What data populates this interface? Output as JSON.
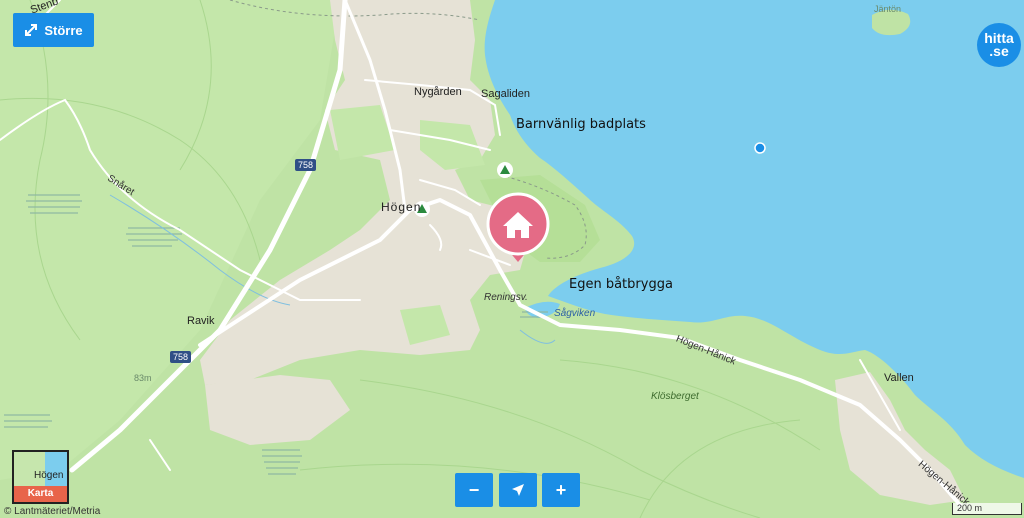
{
  "controls": {
    "larger_label": "Större",
    "zoom_out_label": "−",
    "zoom_in_label": "+"
  },
  "logo": {
    "line1": "hitta",
    "line2": ".se"
  },
  "layer_switcher": {
    "place": "Högen",
    "label": "Karta"
  },
  "attribution": "© Lantmäteriet/Metria",
  "scale_label": "200 m",
  "annotations": {
    "beach": "Barnvänlig badplats",
    "jetty": "Egen båtbrygga"
  },
  "labels": {
    "jantan": "Jäntön",
    "stenb": "Stenb",
    "nygarden": "Nygården",
    "sagaliden": "Sagaliden",
    "hogen": "Högen",
    "snaret": "Snåret",
    "ravik": "Ravik",
    "elevation": "83m",
    "reningsv": "Reningsv.",
    "sagviken": "Sågviken",
    "hogen_hanick_1": "Högen-Hånick",
    "hogen_hanick_2": "Högen-Hånick",
    "klosberget": "Klösberget",
    "vallen": "Vallen"
  },
  "road_numbers": {
    "road_758_a": "758",
    "road_758_b": "758"
  },
  "colors": {
    "land": "#bfe3a5",
    "water": "#7ccdee",
    "built_area": "#e6e2d6",
    "road": "#ffffff",
    "accent": "#1a8ee6",
    "marker": "#e46b86"
  },
  "icons": {
    "marker": "house-marker-icon",
    "campsite": "campsite-icon",
    "expand": "expand-arrows-icon",
    "locate": "navigation-arrow-icon"
  }
}
